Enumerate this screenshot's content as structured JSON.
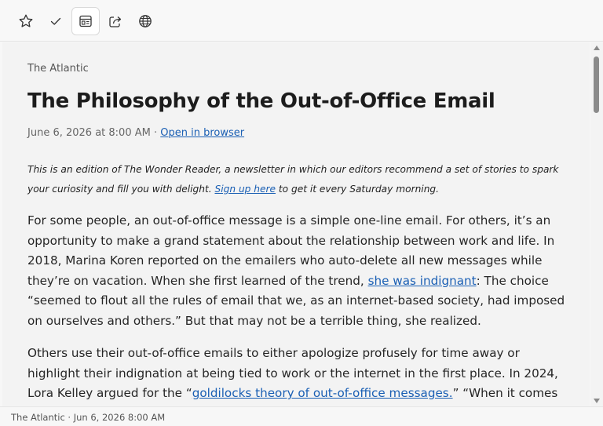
{
  "toolbar": {
    "buttons": [
      {
        "icon": "star-icon",
        "label": "Favorite"
      },
      {
        "icon": "checkmark-icon",
        "label": "Mark as read"
      },
      {
        "icon": "reader-view-icon",
        "label": "Reader view"
      },
      {
        "icon": "share-icon",
        "label": "Share"
      },
      {
        "icon": "globe-icon",
        "label": "Open in browser"
      }
    ]
  },
  "article": {
    "source": "The Atlantic",
    "title": "The Philosophy of the Out-of-Office Email",
    "date": "June 6, 2026 at 8:00 AM",
    "meta_sep": " · ",
    "open_link": "Open in browser",
    "intro_before": "This is an edition of The Wonder Reader, a newsletter in which our editors recommend a set of stories to spark your curiosity and fill you with delight. ",
    "intro_link": "Sign up here",
    "intro_after": " to get it every Saturday morning.",
    "p1_before": "For some people, an out-of-office message is a simple one-line email. For others, it’s an opportunity to make a grand statement about the relationship between work and life. In 2018, Marina Koren reported on the emailers who auto-delete all new messages while they’re on vacation. When she first learned of the trend, ",
    "p1_link": "she was indignant",
    "p1_after": ": The choice “seemed to flout all the rules of email that we, as an internet-based society, had imposed on ourselves and others.” But that may not be a terrible thing, she realized.",
    "p2_before": "Others use their out-of-office emails to either apologize profusely for time away or highlight their indignation at being tied to work or the internet in the first place. In 2024, Lora Kelley argued for the “",
    "p2_link": "goldilocks theory of out-of-office messages.",
    "p2_after": "” “When it comes to sending a note"
  },
  "status": {
    "text": "The Atlantic · Jun 6, 2026 8:00 AM"
  },
  "colors": {
    "link": "#1a5fb4",
    "background": "#f3f3f3",
    "toolbar": "#f8f8f8"
  }
}
